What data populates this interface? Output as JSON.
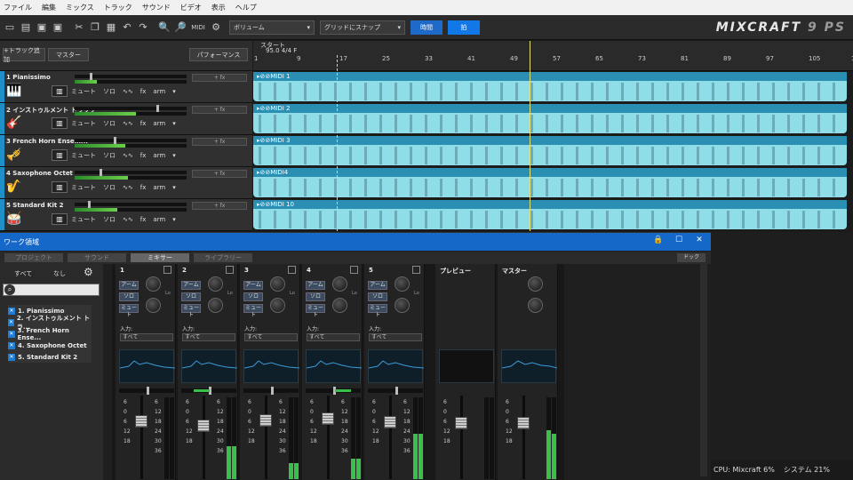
{
  "menu": [
    "ファイル",
    "編集",
    "ミックス",
    "トラック",
    "サウンド",
    "ビデオ",
    "表示",
    "ヘルプ"
  ],
  "toolbar": {
    "volume_label": "ボリューム",
    "snap_label": "グリッドにスナップ",
    "time_label": "時間",
    "beat_label": "拍",
    "logo": "MIXCRAFT",
    "logo_ver": "9 PS"
  },
  "track_header": {
    "add_track": "+トラック追加",
    "master": "マスター",
    "performance": "パフォーマンス"
  },
  "transport": {
    "start_label": "スタート",
    "tempo": "95.0 4/4 F"
  },
  "ruler": [
    "1",
    "9",
    "17",
    "25",
    "33",
    "41",
    "49",
    "57",
    "65",
    "73",
    "81",
    "89",
    "97",
    "105",
    "11"
  ],
  "tracks": [
    {
      "name": "1 Pianissimo",
      "clip": "MIDI 1",
      "fx": "+ fx",
      "meter": 0.2,
      "fader": 0.14
    },
    {
      "name": "2 インストゥルメント トラック",
      "clip": "MIDI 2",
      "fx": "+ fx",
      "meter": 0.55,
      "fader": 0.75
    },
    {
      "name": "3 French Horn Ensem...",
      "clip": "MIDI 3",
      "fx": "+ fx",
      "meter": 0.45,
      "fader": 0.36
    },
    {
      "name": "4 Saxophone Octet",
      "clip": "MIDI4",
      "fx": "+ fx",
      "meter": 0.48,
      "fader": 0.23
    },
    {
      "name": "5 Standard Kit 2",
      "clip": "MIDI 10",
      "fx": "+ fx",
      "meter": 0.38,
      "fader": 0.12
    }
  ],
  "track_buttons": {
    "mute": "ミュート",
    "solo": "ソロ",
    "fx": "fx",
    "arm": "arm"
  },
  "panel": {
    "title": "ワーク領域",
    "tabs": [
      "プロジェクト",
      "サウンド",
      "ミキサー",
      "ライブラリー"
    ],
    "active_tab": "ミキサー",
    "dock": "ドック",
    "filter_all": "すべて",
    "filter_none": "なし",
    "list": [
      "1. Pianissimo",
      "2. インストゥルメント トラ...",
      "3. French Horn Ense...",
      "4. Saxophone Octet",
      "5. Standard Kit 2"
    ]
  },
  "mixer": {
    "strips": [
      {
        "name": "1",
        "pan": 0.5,
        "vu": 0.0,
        "cap": 0.25
      },
      {
        "name": "2",
        "pan": 0.5,
        "vu": 0.4,
        "cap": 0.38
      },
      {
        "name": "3",
        "pan": 0.5,
        "vu": 0.2,
        "cap": 0.23
      },
      {
        "name": "4",
        "pan": 0.5,
        "vu": 0.25,
        "cap": 0.18
      },
      {
        "name": "5",
        "pan": 0.5,
        "vu": 0.55,
        "cap": 0.28
      }
    ],
    "preview": "プレビュー",
    "master": "マスター",
    "arm": "アーム",
    "solo": "ソロ",
    "mute": "ミュート",
    "input_label": "入力:",
    "input_value": "すべて",
    "scale": "6\n0\n6\n12\n18",
    "scale_r": "6\n12\n18\n24\n30\n36",
    "lo": "Lo"
  },
  "status": {
    "cpu": "CPU: Mixcraft 6%",
    "system": "システム 21%"
  }
}
